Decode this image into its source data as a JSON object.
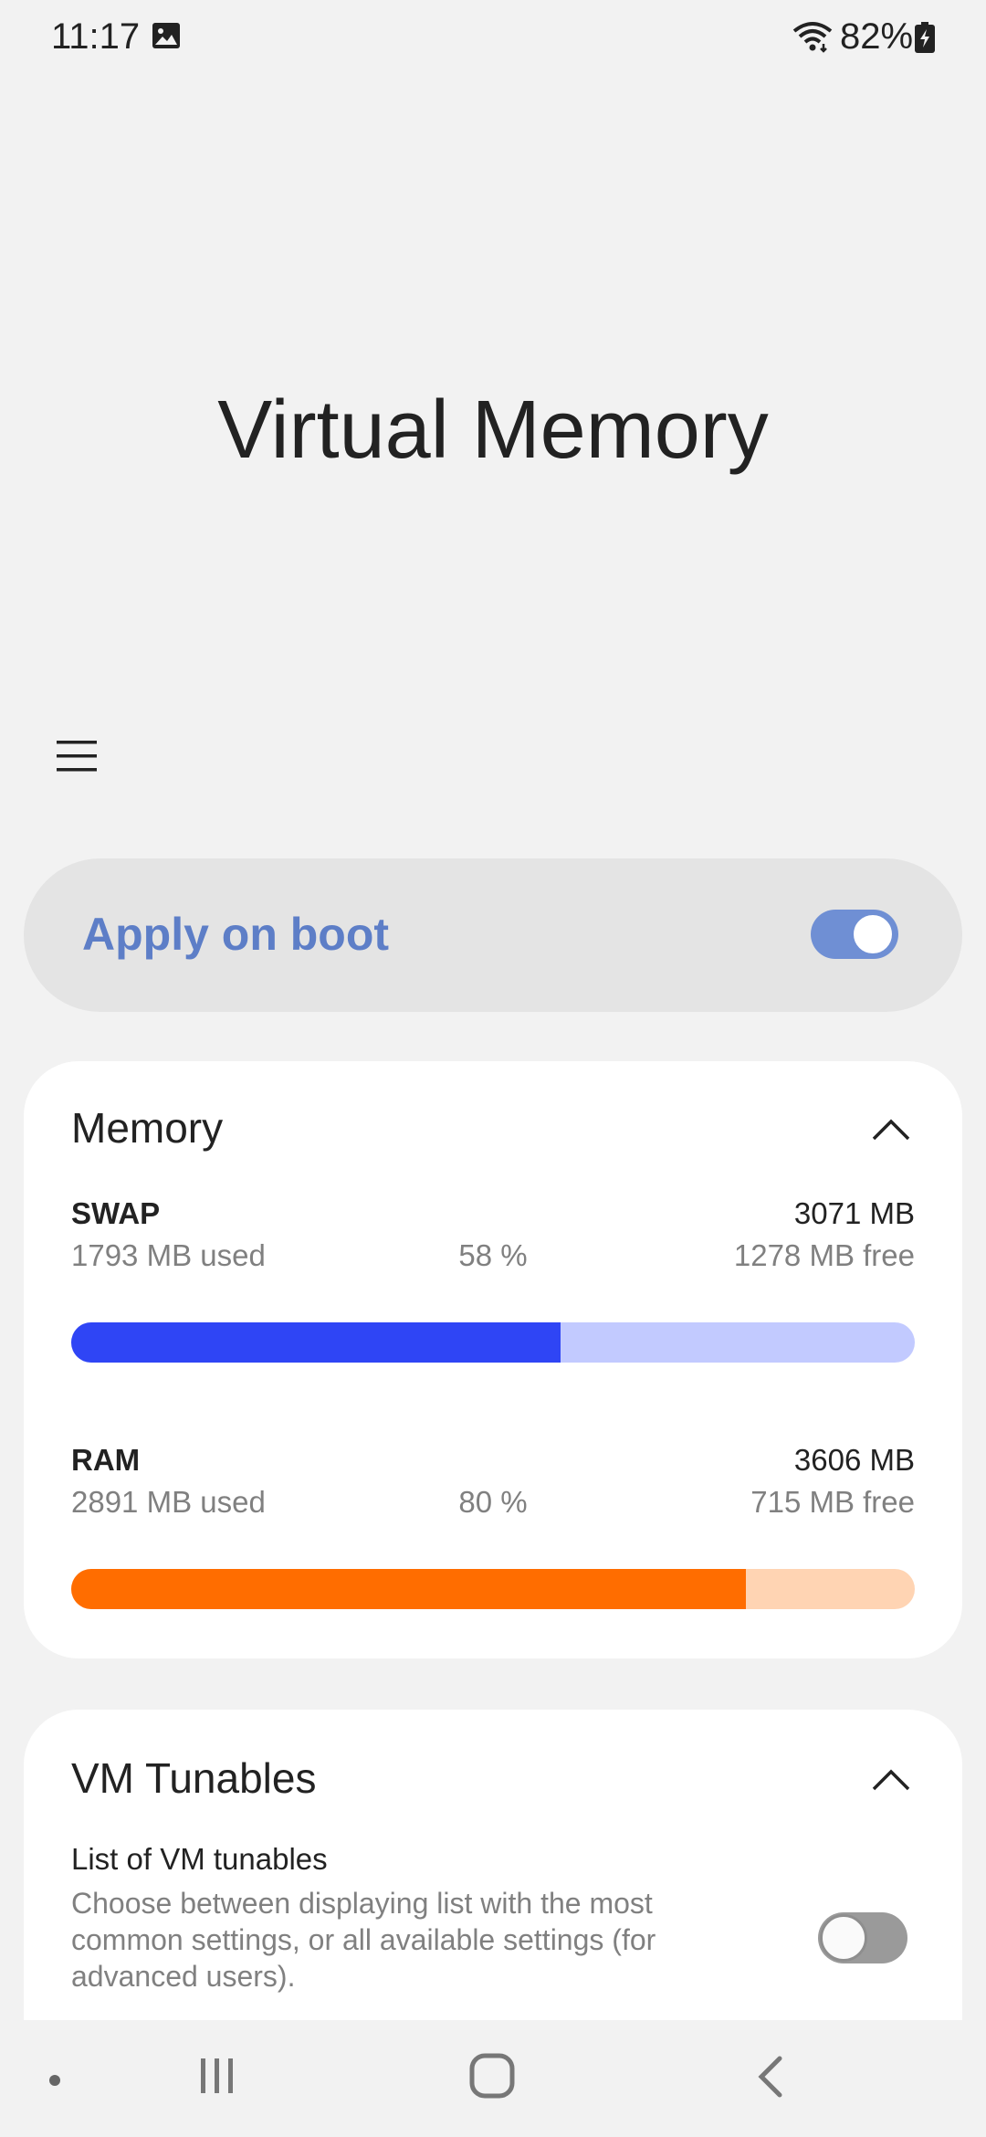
{
  "status_bar": {
    "time": "11:17",
    "battery": "82%",
    "icons": [
      "gallery-notification-icon",
      "wifi-icon",
      "battery-charging-icon"
    ]
  },
  "page": {
    "title": "Virtual Memory",
    "menu_icon": "hamburger-menu-icon"
  },
  "apply_on_boot": {
    "label": "Apply on boot",
    "enabled": true,
    "accent": "#5d7ec7"
  },
  "memory": {
    "title": "Memory",
    "expanded": true,
    "swap": {
      "name": "SWAP",
      "total": "3071 MB",
      "used": "1793 MB used",
      "percent_label": "58 %",
      "free": "1278 MB free",
      "fill_fraction": 0.58,
      "fill_color": "#2f45f5",
      "track_color": "#c2caff"
    },
    "ram": {
      "name": "RAM",
      "total": "3606 MB",
      "used": "2891 MB used",
      "percent_label": "80 %",
      "free": "715 MB free",
      "fill_fraction": 0.8,
      "fill_color": "#ff6d00",
      "track_color": "#ffd4b3"
    }
  },
  "vm_tunables": {
    "title": "VM Tunables",
    "expanded": true,
    "list_setting": {
      "label": "List of VM tunables",
      "description": "Choose between displaying list with the most common settings, or all available settings (for advanced users).",
      "enabled": false
    }
  },
  "nav_bar": {
    "icons": [
      "nav-dot-icon",
      "recent-apps-icon",
      "home-icon",
      "back-icon"
    ]
  }
}
